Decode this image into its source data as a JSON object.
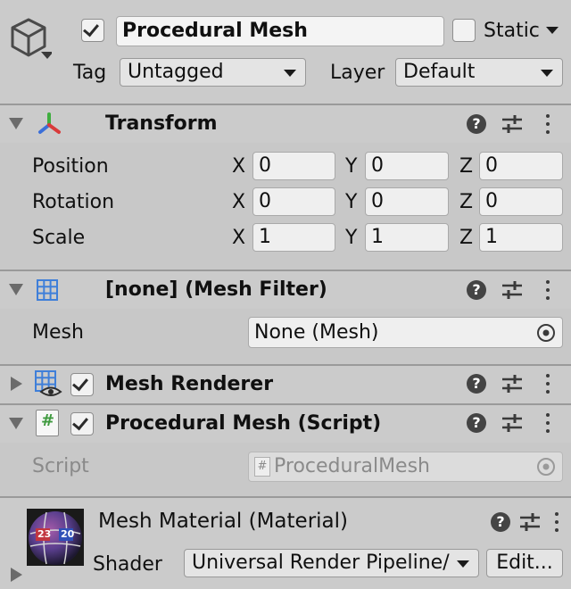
{
  "gameobject": {
    "name": "Procedural Mesh",
    "active": true,
    "static_label": "Static",
    "static_checked": false,
    "tag_label": "Tag",
    "tag_value": "Untagged",
    "layer_label": "Layer",
    "layer_value": "Default"
  },
  "transform": {
    "title": "Transform",
    "rows": [
      {
        "label": "Position",
        "x": "0",
        "y": "0",
        "z": "0"
      },
      {
        "label": "Rotation",
        "x": "0",
        "y": "0",
        "z": "0"
      },
      {
        "label": "Scale",
        "x": "1",
        "y": "1",
        "z": "1"
      }
    ],
    "axis": {
      "x": "X",
      "y": "Y",
      "z": "Z"
    }
  },
  "mesh_filter": {
    "title": "[none] (Mesh Filter)",
    "mesh_label": "Mesh",
    "mesh_value": "None (Mesh)"
  },
  "mesh_renderer": {
    "title": "Mesh Renderer",
    "enabled": true
  },
  "script_component": {
    "title": "Procedural Mesh (Script)",
    "enabled": true,
    "script_label": "Script",
    "script_value": "ProceduralMesh",
    "script_icon_glyph": "#"
  },
  "material": {
    "title": "Mesh Material (Material)",
    "shader_label": "Shader",
    "shader_value": "Universal Render Pipeline/",
    "edit_button": "Edit...",
    "thumb_numbers": [
      "23",
      "20"
    ]
  },
  "icons": {
    "help_glyph": "?",
    "gameobject": "cube-icon",
    "transform": "transform-axes-icon",
    "mesh_filter": "mesh-grid-icon",
    "mesh_renderer": "mesh-renderer-icon",
    "script": "script-file-icon",
    "settings": "sliders-icon",
    "menu": "kebab-menu-icon",
    "object_picker": "object-picker-icon"
  },
  "colors": {
    "panel_bg": "#c8c8c8",
    "field_bg": "#efefef",
    "transform_x": "#d93b3b",
    "transform_y": "#3fae3f",
    "transform_z": "#3b6fd9",
    "mesh_icon_blue": "#3f7fd9",
    "script_icon_green": "#3f9a3f"
  }
}
